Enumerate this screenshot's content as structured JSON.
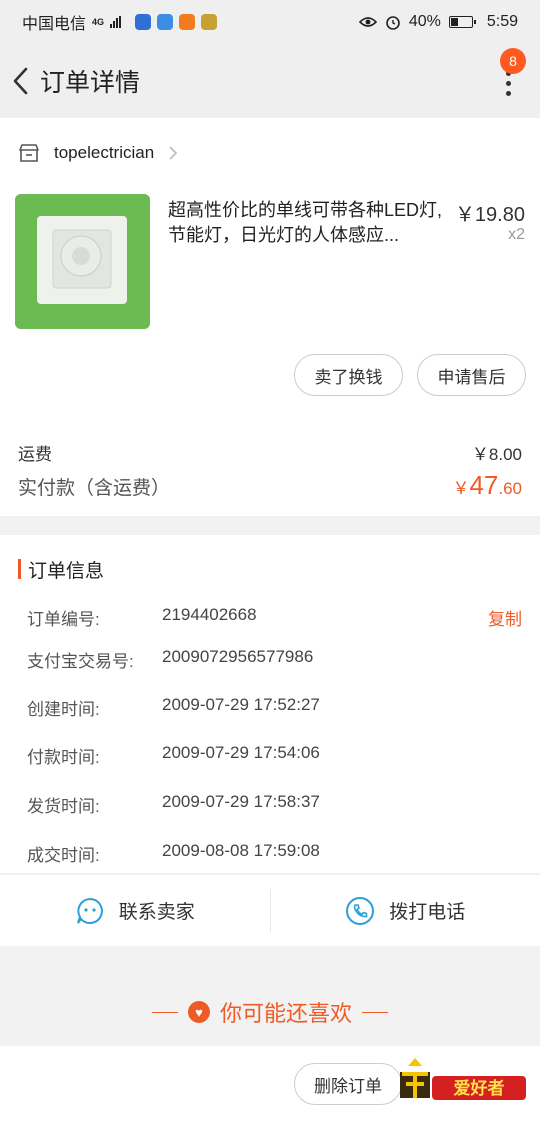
{
  "status_bar": {
    "carrier": "中国电信",
    "network": "4G",
    "battery": "40%",
    "battery_level": 0.4,
    "time": "5:59"
  },
  "header": {
    "title": "订单详情",
    "badge_count": "8"
  },
  "shop": {
    "name": "topelectrician"
  },
  "product": {
    "title": "超高性价比的单线可带各种LED灯,节能灯，日光灯的人体感应...",
    "price": "￥19.80",
    "quantity": "x2"
  },
  "actions": {
    "sell_label": "卖了换钱",
    "after_sales_label": "申请售后"
  },
  "fees": {
    "shipping_label": "运费",
    "shipping_value": "￥8.00",
    "paid_label": "实付款（含运费）",
    "paid_currency": "￥",
    "paid_int": "47",
    "paid_dec": ".60"
  },
  "order_info": {
    "title": "订单信息",
    "copy_label": "复制",
    "rows": [
      {
        "label": "订单编号:",
        "value": "2194402668"
      },
      {
        "label": "支付宝交易号:",
        "value": "2009072956577986"
      },
      {
        "label": "创建时间:",
        "value": "2009-07-29 17:52:27"
      },
      {
        "label": "付款时间:",
        "value": "2009-07-29 17:54:06"
      },
      {
        "label": "发货时间:",
        "value": "2009-07-29 17:58:37"
      },
      {
        "label": "成交时间:",
        "value": "2009-08-08 17:59:08"
      }
    ]
  },
  "contact": {
    "seller_label": "联系卖家",
    "call_label": "拨打电话"
  },
  "recommend": {
    "title": "你可能还喜欢"
  },
  "bottom": {
    "delete_label": "删除订单",
    "watermark_text": "爱好者"
  },
  "colors": {
    "accent": "#f05a24",
    "blue_icon": "#2aa0d8"
  }
}
